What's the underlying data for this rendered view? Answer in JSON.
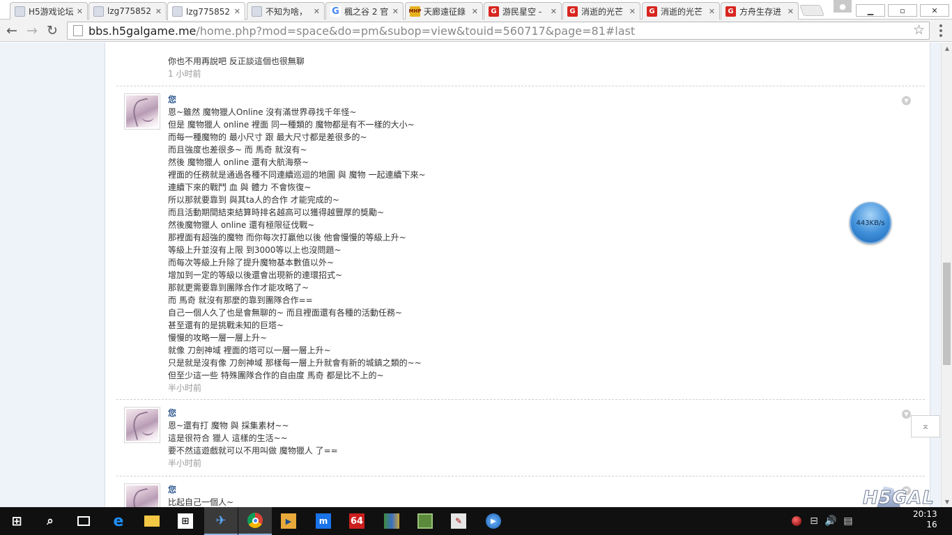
{
  "browser": {
    "tabs": [
      {
        "title": "H5游戏论坛",
        "favicon": "h5-icon",
        "active": false
      },
      {
        "title": "lzg775852",
        "favicon": "h5-icon",
        "active": false
      },
      {
        "title": "lzg775852",
        "favicon": "h5-icon",
        "active": true
      },
      {
        "title": "不知为啥，",
        "favicon": "h5-icon",
        "active": false
      },
      {
        "title": "楓之谷 2 官",
        "favicon": "google-icon",
        "active": false
      },
      {
        "title": "天廊遠征錄",
        "favicon": "mhp-icon",
        "active": false
      },
      {
        "title": "游民星空 -",
        "favicon": "gamersky-icon",
        "active": false
      },
      {
        "title": "消逝的光芒",
        "favicon": "gamersky-icon",
        "active": false
      },
      {
        "title": "消逝的光芒",
        "favicon": "gamersky-icon",
        "active": false
      },
      {
        "title": "方舟生存进",
        "favicon": "gamersky-icon",
        "active": false
      }
    ],
    "url_host": "bbs.h5galgame.me",
    "url_path": "/home.php?mod=space&do=pm&subop=view&touid=560717&page=81#last"
  },
  "messages": {
    "first": {
      "text": "你也不用再說吧  反正談這個也很無聊",
      "time": "1 小时前"
    },
    "items": [
      {
        "author": "您",
        "lines": [
          "恩~雖然 魔物獵人Online 沒有滿世界尋找千年怪~",
          "但是 魔物獵人 online 裡面 同一種類的 魔物都是有不一樣的大小~",
          "而每一種魔物的 最小尺寸 跟 最大尺寸都是差很多的~",
          "而且強度也差很多~ 而 馬奇 就沒有~",
          "然後 魔物獵人 online 還有大航海祭~",
          "裡面的任務就是通過各種不同連續巡迴的地圖 與 魔物 一起連續下來~",
          "連續下來的戰鬥 血 與 體力 不會恢復~",
          "所以那就要靠到 與其ta人的合作 才能完成的~",
          "而且活動期間結束結算時排名越高可以獲得越豐厚的獎勵~",
          "然後魔物獵人 online 還有極限征伐戰~",
          "那裡面有超強的魔物 而你每次打贏他以後 他會慢慢的等級上升~",
          "等級上升並沒有上限 到3000等以上也沒問題~",
          "而每次等級上升除了提升魔物基本數值以外~",
          "增加到一定的等級以後還會出現新的連環招式~",
          "那就更需要靠到團隊合作才能攻略了~",
          "而 馬奇 就沒有那麼的靠到團隊合作==",
          "自己一個人久了也是會無聊的~ 而且裡面還有各種的活動任務~",
          "甚至還有的是挑戰未知的巨塔~",
          "慢慢的攻略一層一層上升~",
          "就像 刀劍神域 裡面的塔可以一層一層上升~",
          "只是就是沒有像 刀劍神域 那樣每一層上升就會有新的城鎮之類的~~",
          "但至少這一些 特殊團隊合作的自由度 馬奇 都是比不上的~"
        ],
        "time": "半小时前"
      },
      {
        "author": "您",
        "lines": [
          "恩~還有打 魔物 與 採集素材~~",
          "這是很符合 獵人 這樣的生活~~",
          "要不然這遊戲就可以不用叫做 魔物獵人 了=="
        ],
        "time": "半小时前"
      },
      {
        "author": "您",
        "lines": [
          "比起自己一個人~"
        ],
        "time": ""
      }
    ]
  },
  "overlay": {
    "speed_text": "443KB/s",
    "brand_text": "H5GAL"
  },
  "taskbar": {
    "apps": [
      "search-icon",
      "task-view-icon",
      "edge-icon",
      "file-explorer-icon",
      "store-icon",
      "feather-app-icon",
      "chrome-icon",
      "video-player-icon",
      "window-app-icon",
      "n64-emulator-icon",
      "books-icon",
      "game-icon",
      "image-editor-icon",
      "media-icon"
    ],
    "n64_label": "64",
    "clock_time": "20:13",
    "clock_date": "16"
  }
}
